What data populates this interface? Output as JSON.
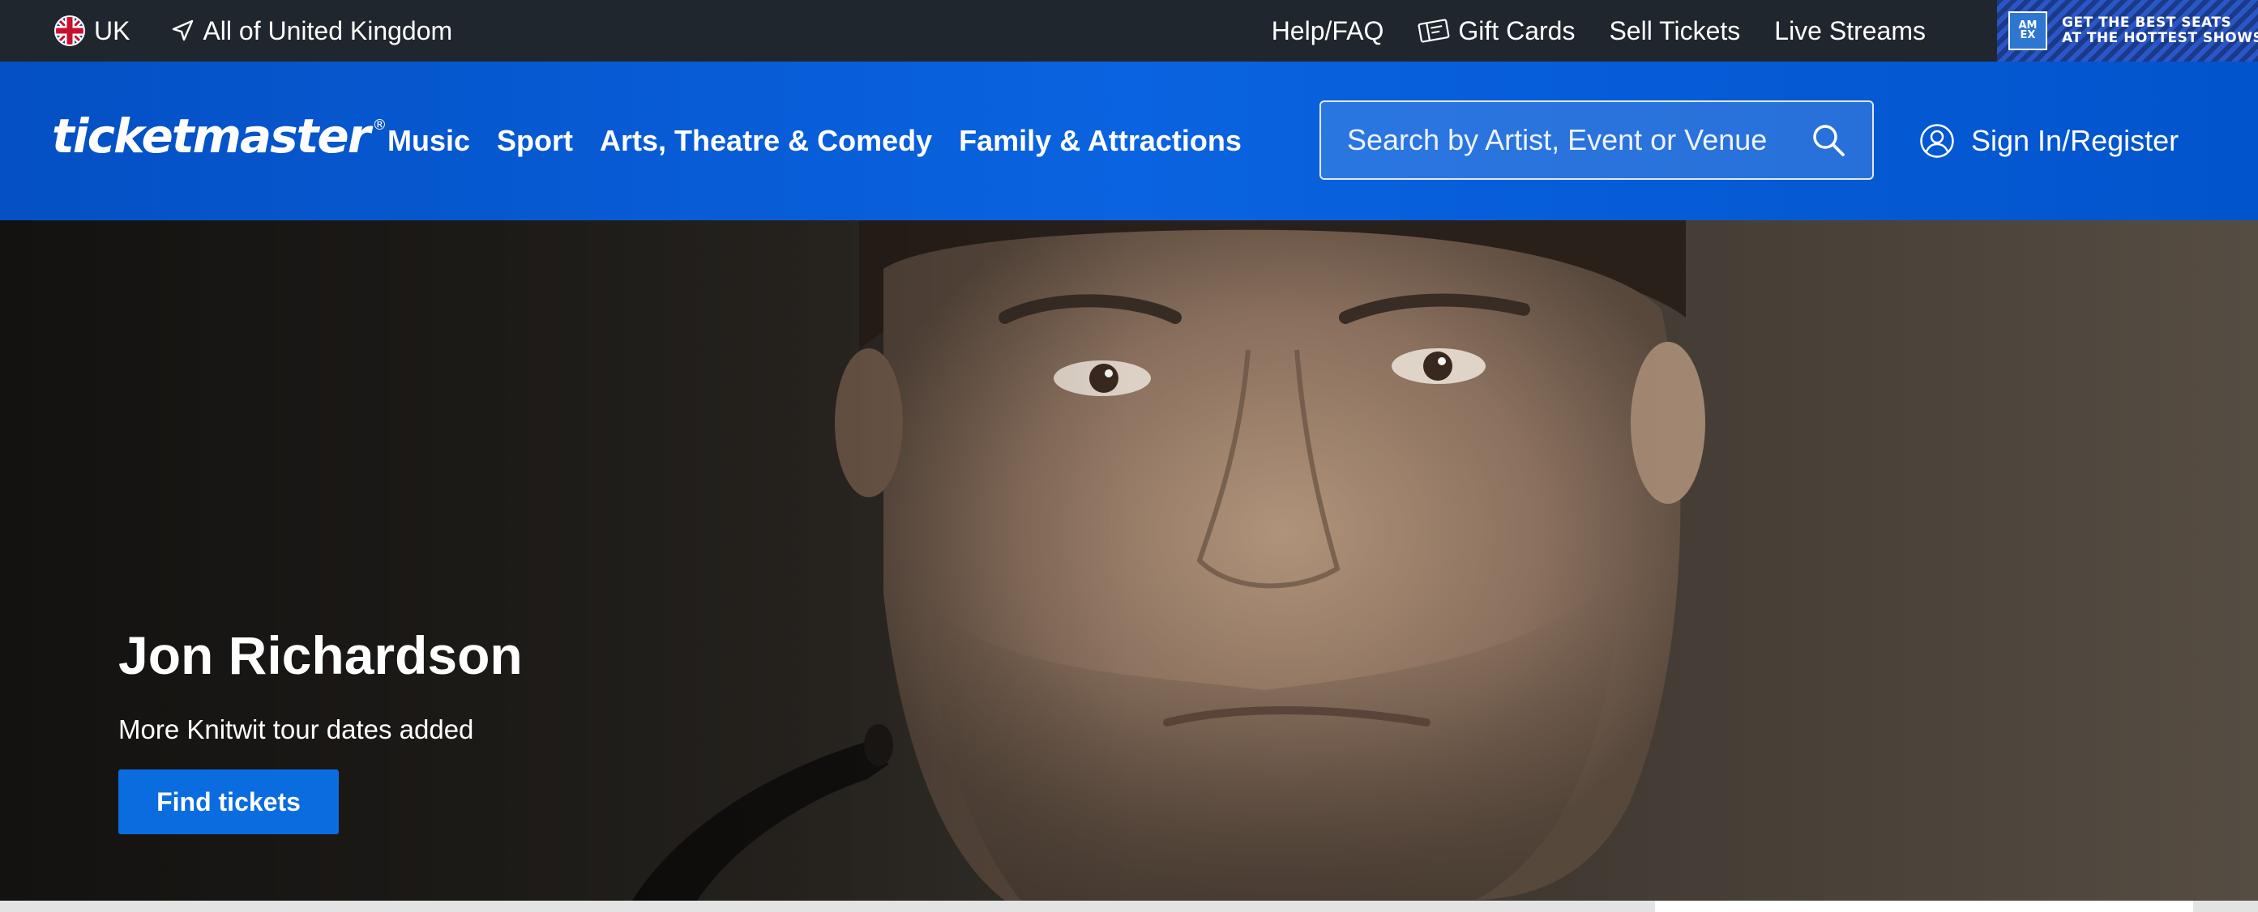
{
  "utility_bar": {
    "country_label": "UK",
    "location_label": "All of United Kingdom",
    "links": [
      {
        "label": "Help/FAQ",
        "icon": ""
      },
      {
        "label": "Gift Cards",
        "icon": "gift-card-icon"
      },
      {
        "label": "Sell Tickets",
        "icon": ""
      },
      {
        "label": "Live Streams",
        "icon": ""
      }
    ],
    "ad": {
      "logo_text": "AM EX",
      "line1": "GET THE BEST SEATS",
      "line2": "AT THE HOTTEST SHOWS"
    }
  },
  "header": {
    "logo_text": "ticketmaster",
    "logo_mark": "®",
    "nav": [
      "Music",
      "Sport",
      "Arts, Theatre & Comedy",
      "Family & Attractions"
    ],
    "search_placeholder": "Search by Artist, Event or Venue",
    "signin_label": "Sign In/Register"
  },
  "hero": {
    "title": "Jon Richardson",
    "subtitle": "More Knitwit tour dates added",
    "button_label": "Find tickets"
  },
  "colors": {
    "utility_bg": "#1f262d",
    "header_blue": "#0a63e0",
    "button_blue": "#0a6cde"
  }
}
